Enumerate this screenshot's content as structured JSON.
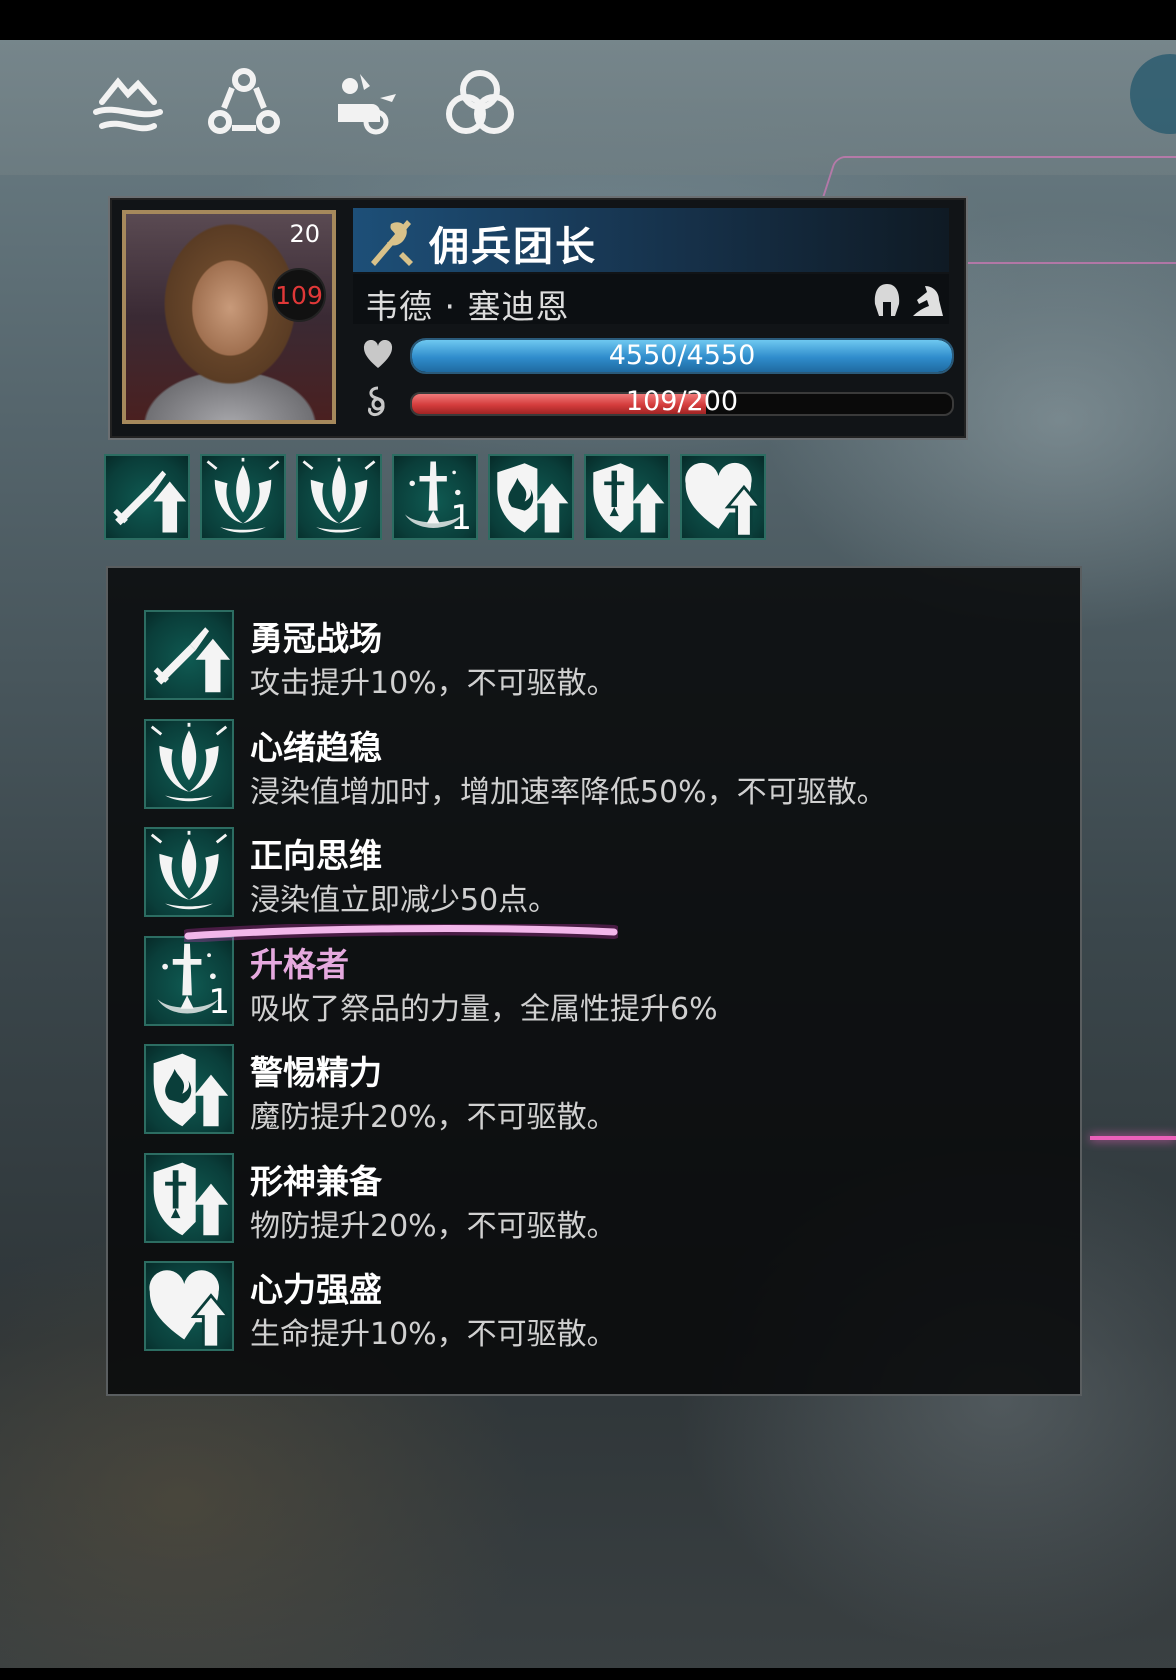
{
  "character": {
    "level": "20",
    "badge_value": "109",
    "class_title": "佣兵团长",
    "name": "韦德 · 塞迪恩",
    "hp": {
      "current": 4550,
      "max": 4550,
      "text": "4550/4550"
    },
    "corruption": {
      "current": 109,
      "max": 200,
      "text": "109/200"
    }
  },
  "nav": {
    "items": [
      "terrain-icon",
      "cycle-icon",
      "ride-icon",
      "knot-icon"
    ]
  },
  "buff_strip": [
    {
      "icon": "sword-up-icon"
    },
    {
      "icon": "calm-mind-icon"
    },
    {
      "icon": "calm-mind-icon"
    },
    {
      "icon": "ascender-icon",
      "stack": "1"
    },
    {
      "icon": "magic-shield-up-icon"
    },
    {
      "icon": "physical-shield-up-icon"
    },
    {
      "icon": "heart-up-icon"
    }
  ],
  "buffs": [
    {
      "name": "勇冠战场",
      "desc": "攻击提升10%，不可驱散。",
      "icon": "sword-up-icon"
    },
    {
      "name": "心绪趋稳",
      "desc": "浸染值增加时，增加速率降低50%，不可驱散。",
      "icon": "calm-mind-icon"
    },
    {
      "name": "正向思维",
      "desc": "浸染值立即减少50点。",
      "icon": "calm-mind-icon"
    },
    {
      "name": "升格者",
      "desc": "吸收了祭品的力量，全属性提升6%",
      "icon": "ascender-icon",
      "stack": "1"
    },
    {
      "name": "警惕精力",
      "desc": "魔防提升20%，不可驱散。",
      "icon": "magic-shield-up-icon"
    },
    {
      "name": "形神兼备",
      "desc": "物防提升20%，不可驱散。",
      "icon": "physical-shield-up-icon"
    },
    {
      "name": "心力强盛",
      "desc": "生命提升10%，不可驱散。",
      "icon": "heart-up-icon"
    }
  ],
  "colors": {
    "hp_bar": "#2f8ccc",
    "corruption_bar": "#d43c3c",
    "buff_icon_bg": "#0a3e3a",
    "annotation_stroke": "#ffffff"
  }
}
